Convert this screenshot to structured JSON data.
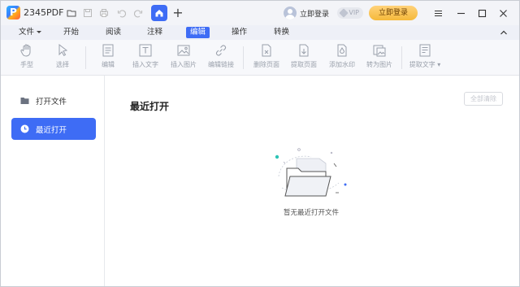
{
  "app": {
    "title": "2345PDF"
  },
  "titlebar": {
    "quick_icons": [
      "open-folder-icon",
      "save-icon",
      "print-icon",
      "undo-icon",
      "redo-icon"
    ],
    "home_tab_icon": "home-icon",
    "new_tab_symbol": "+",
    "login_link": "立即登录",
    "vip_badge": "VIP",
    "login_button": "立即登录",
    "window_controls": [
      "menu-icon",
      "minimize-icon",
      "maximize-icon",
      "close-icon"
    ]
  },
  "menubar": {
    "items": [
      {
        "label": "文件"
      },
      {
        "label": "开始"
      },
      {
        "label": "阅读"
      },
      {
        "label": "注释"
      },
      {
        "label": "编辑"
      },
      {
        "label": "操作"
      },
      {
        "label": "转换"
      }
    ],
    "active": "编辑"
  },
  "ribbon": {
    "tools": [
      {
        "label": "手型",
        "icon": "hand-icon"
      },
      {
        "label": "选择",
        "icon": "cursor-icon"
      },
      {
        "label": "编辑",
        "icon": "edit-text-icon"
      },
      {
        "label": "插入文字",
        "icon": "insert-text-icon"
      },
      {
        "label": "插入图片",
        "icon": "insert-image-icon"
      },
      {
        "label": "编辑链接",
        "icon": "link-icon"
      },
      {
        "label": "删除页面",
        "icon": "delete-page-icon"
      },
      {
        "label": "提取页面",
        "icon": "extract-page-icon"
      },
      {
        "label": "添加水印",
        "icon": "watermark-icon"
      },
      {
        "label": "转为图片",
        "icon": "to-image-icon"
      },
      {
        "label": "提取文字",
        "icon": "extract-text-icon"
      }
    ]
  },
  "sidebar": {
    "items": [
      {
        "label": "打开文件",
        "icon": "folder-icon"
      },
      {
        "label": "最近打开",
        "icon": "clock-icon"
      }
    ],
    "active": "最近打开"
  },
  "main": {
    "title": "最近打开",
    "clear_button": "全部清除",
    "empty_text": "暂无最近打开文件"
  },
  "colors": {
    "accent": "#3e6cf5",
    "login_button": "#f5b93a",
    "titlebar_bg": "#f3f4f8",
    "menubar_bg": "#eef0f7",
    "disabled_text": "#9aa0ab"
  }
}
